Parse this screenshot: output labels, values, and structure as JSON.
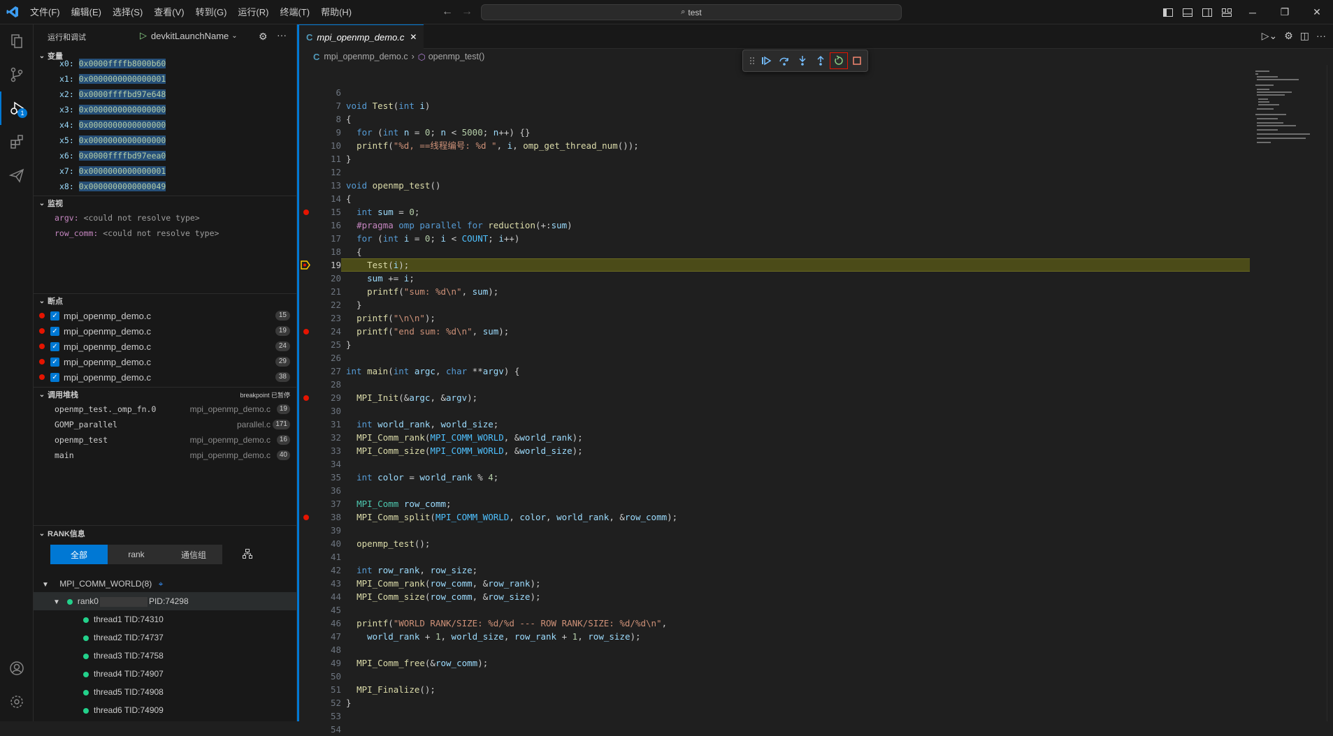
{
  "menu": [
    "文件(F)",
    "编辑(E)",
    "选择(S)",
    "查看(V)",
    "转到(G)",
    "运行(R)",
    "终端(T)",
    "帮助(H)"
  ],
  "search": {
    "text": "test"
  },
  "sidebar": {
    "title": "运行和调试",
    "launch_config": "devkitLaunchName",
    "variables": {
      "header": "变量",
      "items": [
        {
          "name": "x0:",
          "value": "0x0000ffffb8000b60"
        },
        {
          "name": "x1:",
          "value": "0x0000000000000001"
        },
        {
          "name": "x2:",
          "value": "0x0000ffffbd97e648"
        },
        {
          "name": "x3:",
          "value": "0x0000000000000000"
        },
        {
          "name": "x4:",
          "value": "0x0000000000000000"
        },
        {
          "name": "x5:",
          "value": "0x0000000000000000"
        },
        {
          "name": "x6:",
          "value": "0x0000ffffbd97eea0"
        },
        {
          "name": "x7:",
          "value": "0x0000000000000001"
        },
        {
          "name": "x8:",
          "value": "0x0000000000000049"
        }
      ]
    },
    "watch": {
      "header": "监视",
      "items": [
        {
          "name": "argv:",
          "value": "<could not resolve type>"
        },
        {
          "name": "row_comm:",
          "value": "<could not resolve type>"
        }
      ]
    },
    "breakpoints": {
      "header": "断点",
      "items": [
        {
          "file": "mpi_openmp_demo.c",
          "line": "15"
        },
        {
          "file": "mpi_openmp_demo.c",
          "line": "19"
        },
        {
          "file": "mpi_openmp_demo.c",
          "line": "24"
        },
        {
          "file": "mpi_openmp_demo.c",
          "line": "29"
        },
        {
          "file": "mpi_openmp_demo.c",
          "line": "38"
        }
      ]
    },
    "callstack": {
      "header": "调用堆栈",
      "status": "breakpoint 已暂停",
      "items": [
        {
          "func": "openmp_test._omp_fn.0",
          "file": "mpi_openmp_demo.c",
          "line": "19"
        },
        {
          "func": "GOMP_parallel",
          "file": "parallel.c",
          "line": "171"
        },
        {
          "func": "openmp_test",
          "file": "mpi_openmp_demo.c",
          "line": "16"
        },
        {
          "func": "main",
          "file": "mpi_openmp_demo.c",
          "line": "40"
        }
      ]
    },
    "rank": {
      "header": "RANK信息",
      "tabs": [
        "全部",
        "rank",
        "通信组"
      ],
      "comm_world": "MPI_COMM_WORLD(8)",
      "rank_label": "rank0",
      "rank_pid": "PID:74298",
      "threads": [
        "thread1 TID:74310",
        "thread2 TID:74737",
        "thread3 TID:74758",
        "thread4 TID:74907",
        "thread5 TID:74908",
        "thread6 TID:74909"
      ]
    }
  },
  "editor": {
    "tab": "mpi_openmp_demo.c",
    "breadcrumb": [
      "mpi_openmp_demo.c",
      "openmp_test()"
    ],
    "current_line": 19,
    "breakpoint_lines": [
      15,
      24,
      29,
      38
    ],
    "lines": [
      {
        "n": "6",
        "t": ""
      },
      {
        "n": "7",
        "t": "void Test(int i)"
      },
      {
        "n": "8",
        "t": "{"
      },
      {
        "n": "9",
        "t": "  for (int n = 0; n < 5000; n++) {}"
      },
      {
        "n": "10",
        "t": "  printf(\"%d, ==线程编号: %d \", i, omp_get_thread_num());"
      },
      {
        "n": "11",
        "t": "}"
      },
      {
        "n": "12",
        "t": ""
      },
      {
        "n": "13",
        "t": "void openmp_test()"
      },
      {
        "n": "14",
        "t": "{"
      },
      {
        "n": "15",
        "t": "  int sum = 0;"
      },
      {
        "n": "16",
        "t": "  #pragma omp parallel for reduction(+:sum)"
      },
      {
        "n": "17",
        "t": "  for (int i = 0; i < COUNT; i++)"
      },
      {
        "n": "18",
        "t": "  {"
      },
      {
        "n": "19",
        "t": "    Test(i);"
      },
      {
        "n": "20",
        "t": "    sum += i;"
      },
      {
        "n": "21",
        "t": "    printf(\"sum: %d\\n\", sum);"
      },
      {
        "n": "22",
        "t": "  }"
      },
      {
        "n": "23",
        "t": "  printf(\"\\n\\n\");"
      },
      {
        "n": "24",
        "t": "  printf(\"end sum: %d\\n\", sum);"
      },
      {
        "n": "25",
        "t": "}"
      },
      {
        "n": "26",
        "t": ""
      },
      {
        "n": "27",
        "t": "int main(int argc, char **argv) {"
      },
      {
        "n": "28",
        "t": ""
      },
      {
        "n": "29",
        "t": "  MPI_Init(&argc, &argv);"
      },
      {
        "n": "30",
        "t": ""
      },
      {
        "n": "31",
        "t": "  int world_rank, world_size;"
      },
      {
        "n": "32",
        "t": "  MPI_Comm_rank(MPI_COMM_WORLD, &world_rank);"
      },
      {
        "n": "33",
        "t": "  MPI_Comm_size(MPI_COMM_WORLD, &world_size);"
      },
      {
        "n": "34",
        "t": ""
      },
      {
        "n": "35",
        "t": "  int color = world_rank % 4;"
      },
      {
        "n": "36",
        "t": ""
      },
      {
        "n": "37",
        "t": "  MPI_Comm row_comm;"
      },
      {
        "n": "38",
        "t": "  MPI_Comm_split(MPI_COMM_WORLD, color, world_rank, &row_comm);"
      },
      {
        "n": "39",
        "t": ""
      },
      {
        "n": "40",
        "t": "  openmp_test();"
      },
      {
        "n": "41",
        "t": ""
      },
      {
        "n": "42",
        "t": "  int row_rank, row_size;"
      },
      {
        "n": "43",
        "t": "  MPI_Comm_rank(row_comm, &row_rank);"
      },
      {
        "n": "44",
        "t": "  MPI_Comm_size(row_comm, &row_size);"
      },
      {
        "n": "45",
        "t": ""
      },
      {
        "n": "46",
        "t": "  printf(\"WORLD RANK/SIZE: %d/%d --- ROW RANK/SIZE: %d/%d\\n\","
      },
      {
        "n": "47",
        "t": "    world_rank + 1, world_size, row_rank + 1, row_size);"
      },
      {
        "n": "48",
        "t": ""
      },
      {
        "n": "49",
        "t": "  MPI_Comm_free(&row_comm);"
      },
      {
        "n": "50",
        "t": ""
      },
      {
        "n": "51",
        "t": "  MPI_Finalize();"
      },
      {
        "n": "52",
        "t": "}"
      },
      {
        "n": "53",
        "t": ""
      },
      {
        "n": "54",
        "t": ""
      }
    ]
  },
  "colors": {
    "accent": "#0078d4",
    "breakpoint": "#e51400",
    "current_line": "#4b4b18",
    "thread": "#23d18b"
  },
  "icons": [
    "explorer-icon",
    "source-control-icon",
    "run-debug-icon",
    "extensions-icon",
    "send-icon",
    "account-icon",
    "settings-icon"
  ]
}
